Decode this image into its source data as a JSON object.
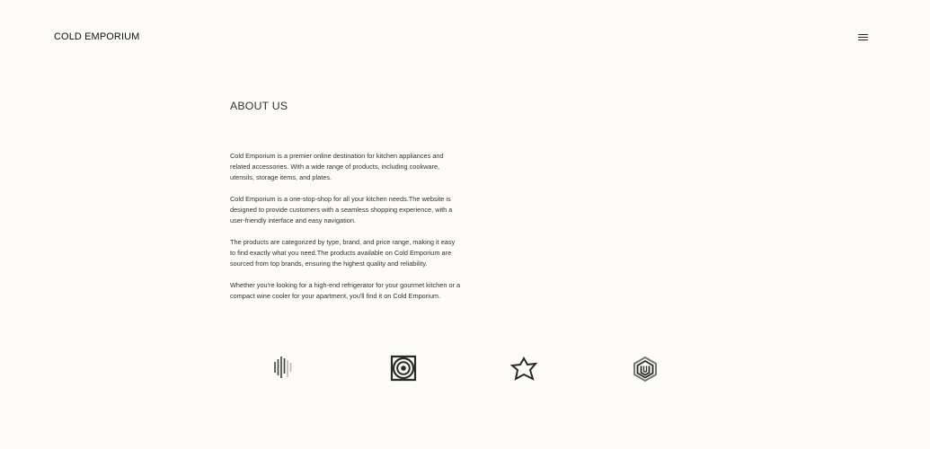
{
  "header": {
    "brand": "COLD EMPORIUM",
    "menu_icon": "hamburger-menu-icon"
  },
  "about": {
    "title": "ABOUT US",
    "paragraphs": [
      "Cold Emporium is a premier online destination for kitchen appliances and related accessories. With a wide range of products, including cookware, utensils, storage items, and plates.",
      "Cold Emporium is a one-stop-shop for all your kitchen needs.The website is designed to provide customers with a seamless shopping experience, with a user-friendly interface and easy navigation.",
      "The products are categorized by type, brand, and price range, making it easy to find exactly what you need.The products available on Cold Emporium are sourced from top brands, ensuring the highest quality and reliability.",
      "Whether you're looking for a high-end refrigerator for your gourmet kitchen or a compact wine cooler for your apartment, you'll find it on Cold Emporium."
    ]
  },
  "logos": [
    {
      "icon": "vertical-bars-logo-icon"
    },
    {
      "icon": "concentric-circle-logo-icon"
    },
    {
      "icon": "star-burst-logo-icon"
    },
    {
      "icon": "hexagon-monogram-logo-icon"
    }
  ]
}
